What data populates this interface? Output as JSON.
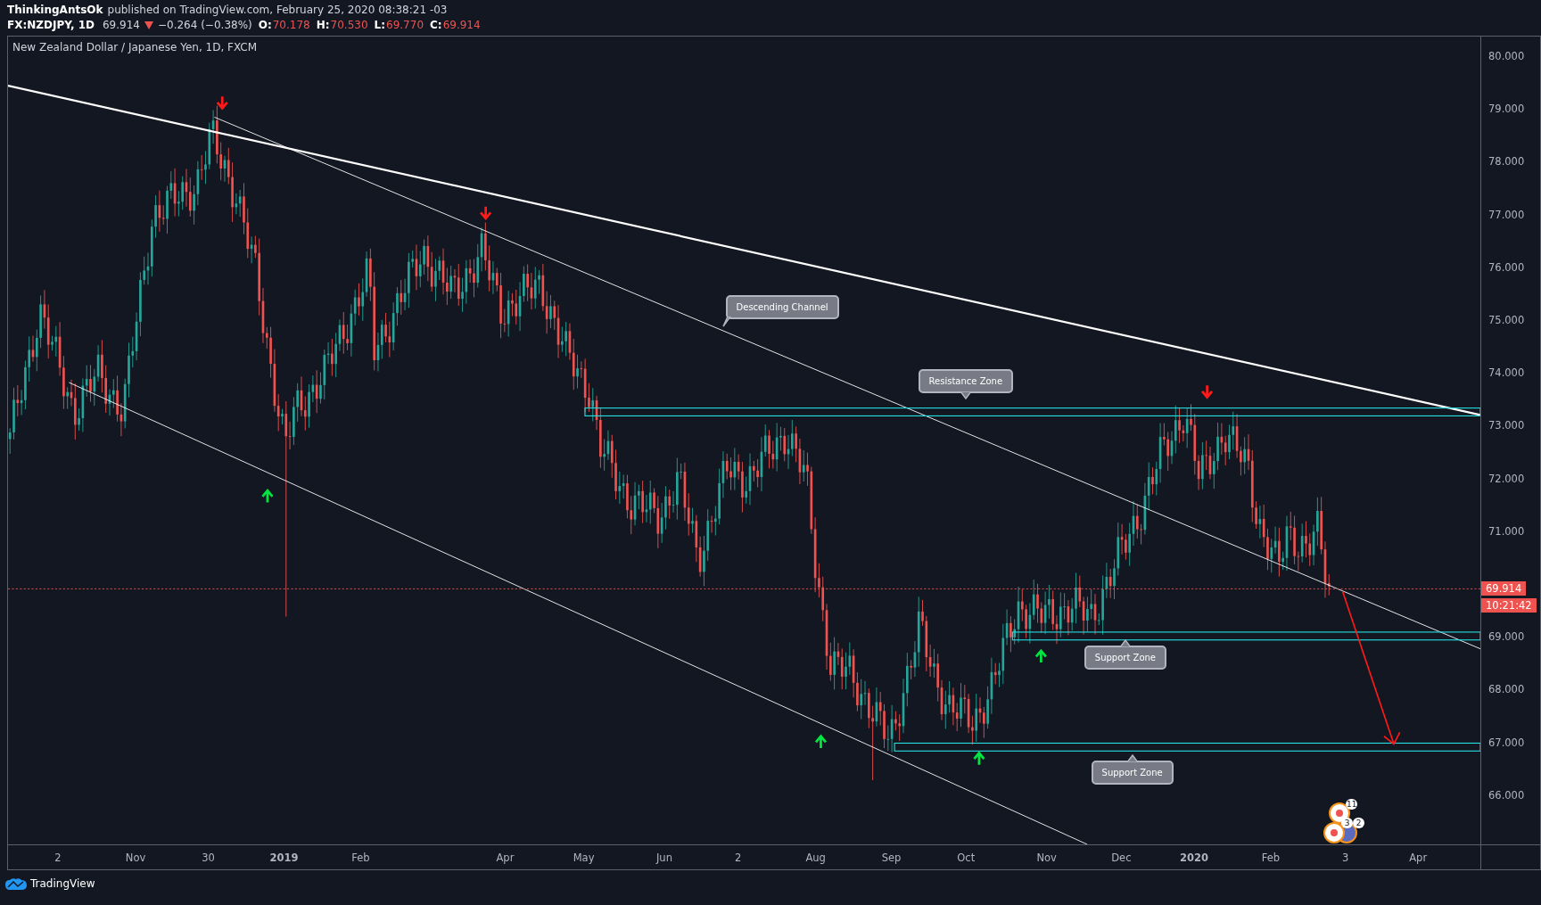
{
  "header": {
    "author": "ThinkingAntsOk",
    "published": "published on TradingView.com, February 25, 2020 08:38:21 -03"
  },
  "quote": {
    "symbol": "FX:NZDJPY, 1D",
    "last": "69.914",
    "down": true,
    "change": "−0.264 (−0.38%)",
    "ohlc": [
      {
        "label": "O:",
        "value": "70.178"
      },
      {
        "label": "H:",
        "value": "70.530"
      },
      {
        "label": "L:",
        "value": "69.770"
      },
      {
        "label": "C:",
        "value": "69.914"
      }
    ]
  },
  "chart": {
    "title": "New Zealand Dollar / Japanese Yen, 1D, FXCM",
    "price_axis": [
      "80.000",
      "79.000",
      "78.000",
      "77.000",
      "76.000",
      "75.000",
      "74.000",
      "73.000",
      "72.000",
      "71.000",
      "69.000",
      "68.000",
      "67.000",
      "66.000"
    ],
    "last_price_tag": "69.914",
    "countdown_tag": "10:21:42",
    "time_axis": [
      {
        "label": "2",
        "bold": false
      },
      {
        "label": "Nov",
        "bold": false
      },
      {
        "label": "30",
        "bold": false
      },
      {
        "label": "2019",
        "bold": true
      },
      {
        "label": "Feb",
        "bold": false
      },
      {
        "label": "Apr",
        "bold": false
      },
      {
        "label": "May",
        "bold": false
      },
      {
        "label": "Jun",
        "bold": false
      },
      {
        "label": "2",
        "bold": false
      },
      {
        "label": "Aug",
        "bold": false
      },
      {
        "label": "Sep",
        "bold": false
      },
      {
        "label": "Oct",
        "bold": false
      },
      {
        "label": "Nov",
        "bold": false
      },
      {
        "label": "Dec",
        "bold": false
      },
      {
        "label": "2020",
        "bold": true
      },
      {
        "label": "Feb",
        "bold": false
      },
      {
        "label": "3",
        "bold": false
      },
      {
        "label": "Apr",
        "bold": false
      }
    ],
    "annotations": [
      {
        "text": "Descending Channel",
        "kind": "down-left"
      },
      {
        "text": "Resistance Zone",
        "kind": "down"
      },
      {
        "text": "Support Zone",
        "kind": "up"
      },
      {
        "text": "Support Zone",
        "kind": "up"
      }
    ],
    "event_badges": [
      "11",
      "3",
      "2"
    ]
  },
  "footer": {
    "brand": "TradingView"
  }
}
